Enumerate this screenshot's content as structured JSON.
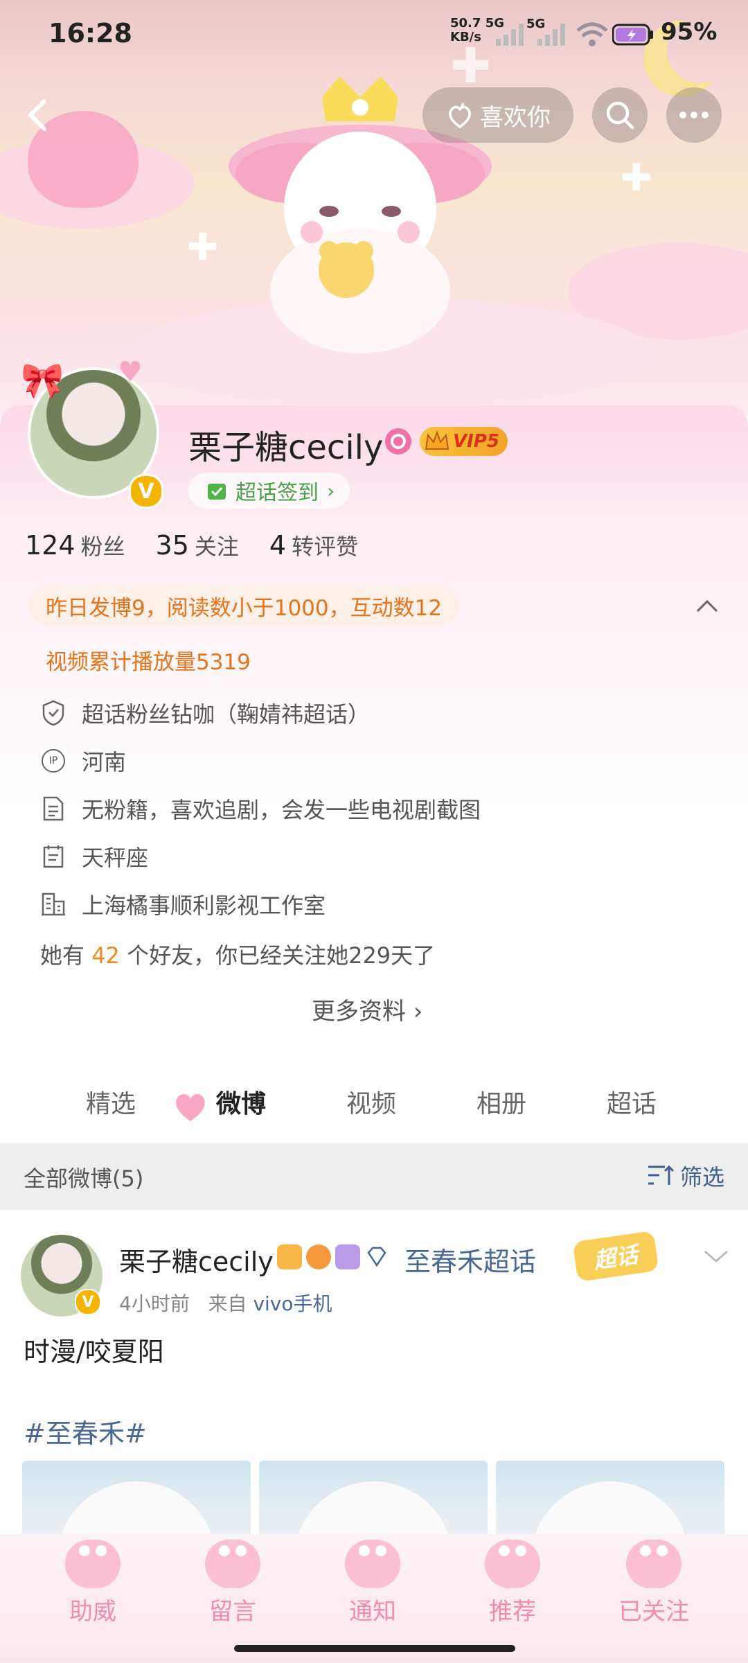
{
  "status_bar": {
    "time": "16:28",
    "net_speed_value": "50.7",
    "net_speed_unit": "KB/s",
    "net_type_1": "5G",
    "net_type_2": "5G",
    "battery": "95%"
  },
  "header": {
    "like_label": "喜欢你"
  },
  "profile": {
    "name": "栗子糖cecily",
    "vip_label": "VIP5",
    "checkin_label": "超话签到",
    "verified_badge": "V",
    "stats": [
      {
        "value": "124",
        "label": "粉丝"
      },
      {
        "value": "35",
        "label": "关注"
      },
      {
        "value": "4",
        "label": "转评赞"
      }
    ],
    "highlight_1": "昨日发博9，阅读数小于1000，互动数12",
    "highlight_2": "视频累计播放量5319",
    "info": [
      {
        "icon": "shield-icon",
        "text": "超话粉丝钻咖（鞠婧祎超话）"
      },
      {
        "icon": "ip-icon",
        "icon_text": "IP",
        "text": "河南"
      },
      {
        "icon": "document-icon",
        "text": "无粉籍，喜欢追剧，会发一些电视剧截图"
      },
      {
        "icon": "calendar-icon",
        "text": "天秤座"
      },
      {
        "icon": "company-icon",
        "text": "上海橘事顺利影视工作室"
      }
    ],
    "friends_prefix": "她有",
    "friends_count": "42",
    "friends_suffix": "个好友，你已经关注她229天了",
    "more_info": "更多资料 ›"
  },
  "tabs": [
    "精选",
    "微博",
    "视频",
    "相册",
    "超话"
  ],
  "active_tab": 1,
  "feed": {
    "section_title": "全部微博(5)",
    "filter_label": "筛选",
    "post": {
      "author": "栗子糖cecily",
      "topic": "至春禾超话",
      "sticker": "超话",
      "time": "4小时前",
      "source_prefix": "来自",
      "source": "vivo手机",
      "text": "时漫/咬夏阳",
      "hashtag": "#至春禾#"
    }
  },
  "bottom_nav": [
    "助威",
    "留言",
    "通知",
    "推荐",
    "已关注"
  ],
  "colors": {
    "accent_orange": "#e5731a",
    "link_blue": "#4a6894",
    "checkin_green": "#47a247",
    "nav_pink": "#f08cb0"
  }
}
